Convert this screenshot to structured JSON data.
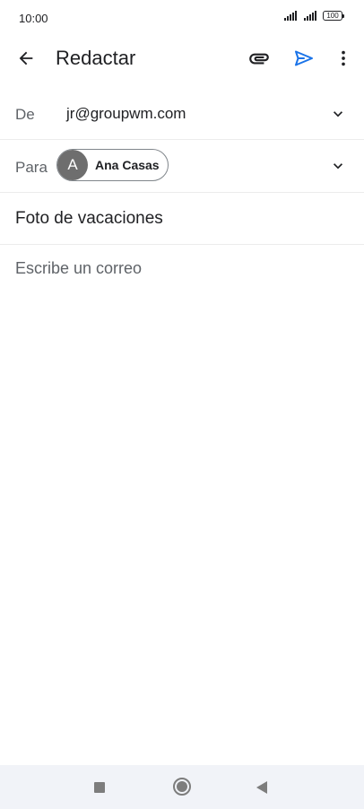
{
  "status_bar": {
    "time": "10:00",
    "battery": "100",
    "icons": [
      "signal-icon",
      "signal-icon",
      "battery-icon"
    ]
  },
  "app_bar": {
    "title": "Redactar",
    "icons": [
      "back-arrow-icon",
      "attach-icon",
      "send-icon",
      "more-vert-icon"
    ]
  },
  "compose": {
    "from_label": "De",
    "from_value": "jr@groupwm.com",
    "to_label": "Para",
    "to_chip": {
      "initial": "A",
      "name": "Ana Casas"
    },
    "subject": "Foto de vacaciones",
    "body_placeholder": "Escribe un correo"
  },
  "colors": {
    "send_accent": "#1a73e8",
    "text_primary": "#202124",
    "text_secondary": "#5f6368",
    "avatar_bg": "#6e6e6e",
    "nav_bg": "#f1f3f8"
  },
  "nav_bar": {
    "icons": [
      "recents-square-icon",
      "home-circle-icon",
      "back-triangle-icon"
    ]
  }
}
